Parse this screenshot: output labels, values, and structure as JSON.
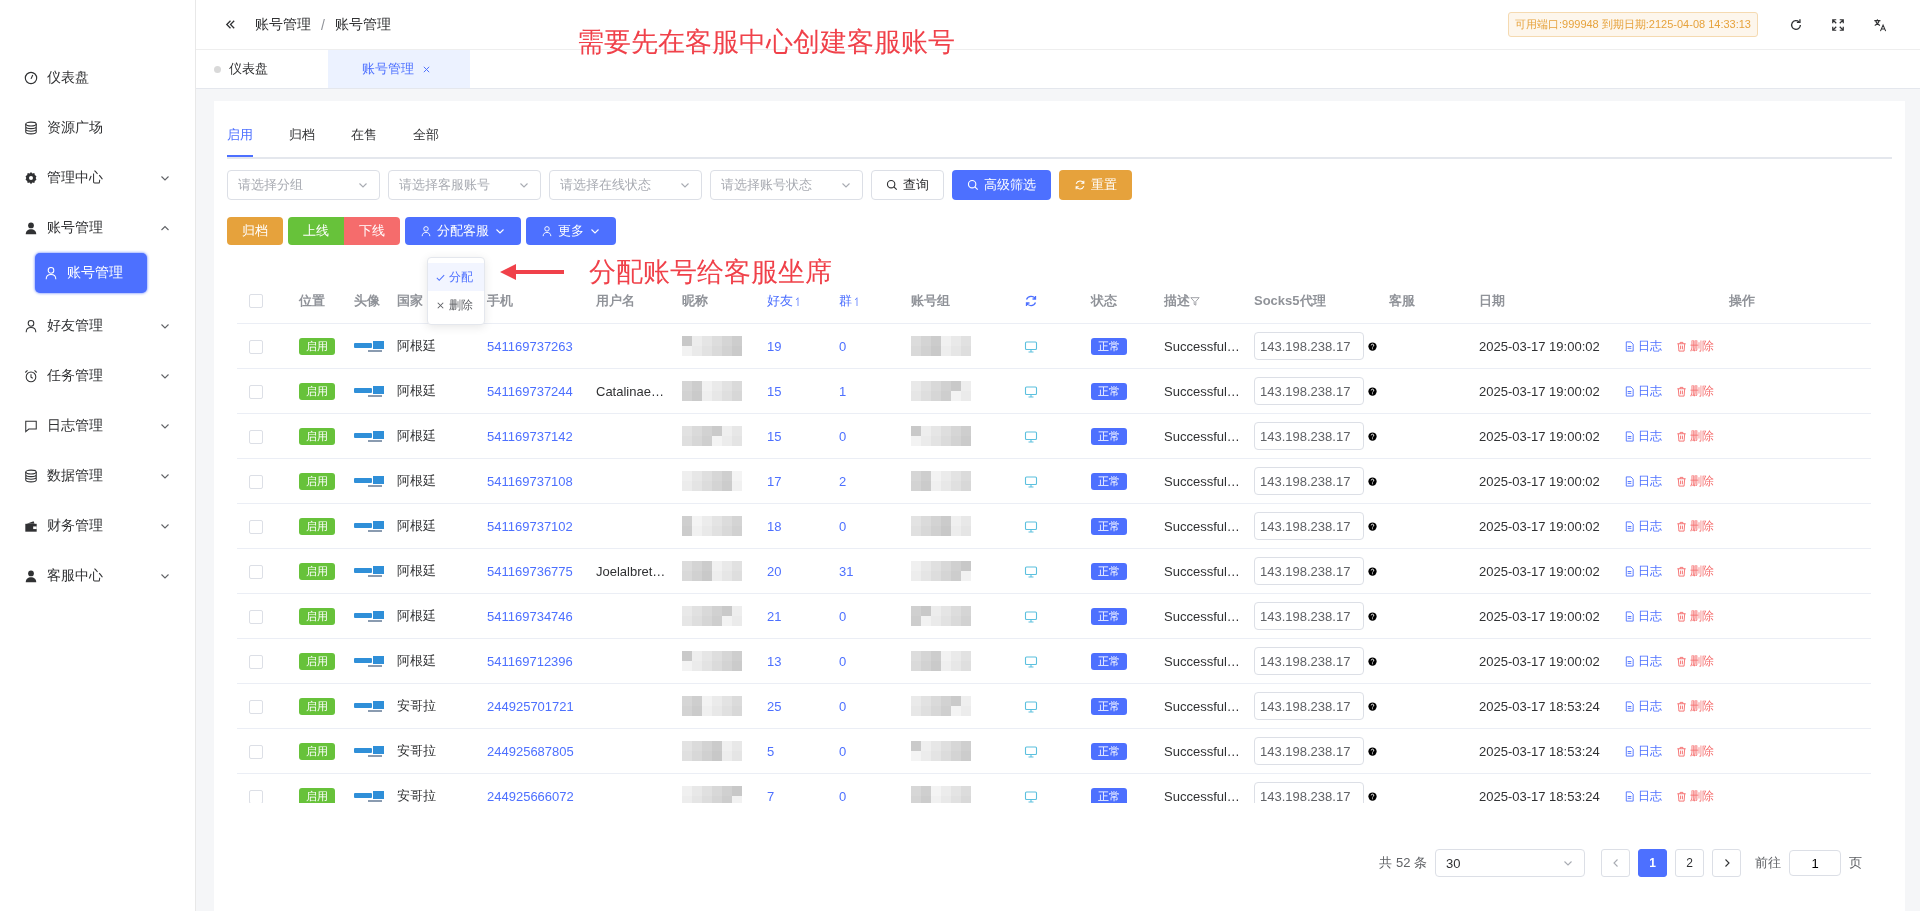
{
  "sidebar": {
    "items": [
      {
        "label": "仪表盘",
        "kind": "link",
        "selected": false
      },
      {
        "label": "资源广场",
        "kind": "link",
        "selected": false
      },
      {
        "label": "管理中心",
        "kind": "group",
        "expanded": false,
        "selected": false
      },
      {
        "label": "账号管理",
        "kind": "group",
        "expanded": true,
        "selected": false,
        "children": [
          {
            "label": "账号管理",
            "selected": true
          }
        ]
      },
      {
        "label": "好友管理",
        "kind": "group",
        "expanded": false,
        "selected": false
      },
      {
        "label": "任务管理",
        "kind": "group",
        "expanded": false,
        "selected": false
      },
      {
        "label": "日志管理",
        "kind": "group",
        "expanded": false,
        "selected": false
      },
      {
        "label": "数据管理",
        "kind": "group",
        "expanded": false,
        "selected": false
      },
      {
        "label": "财务管理",
        "kind": "group",
        "expanded": false,
        "selected": false
      },
      {
        "label": "客服中心",
        "kind": "group",
        "expanded": false,
        "selected": false
      }
    ]
  },
  "header": {
    "breadcrumb": [
      "账号管理",
      "账号管理"
    ],
    "breadcrumb_separator": "/",
    "license_badge": "可用端口:999948 到期日期:2125-04-08 14:33:13"
  },
  "page_tabs": [
    {
      "label": "仪表盘",
      "selected": false,
      "closable": false
    },
    {
      "label": "账号管理",
      "selected": true,
      "closable": true
    }
  ],
  "annotations": {
    "top_note": "需要先在客服中心创建客服账号",
    "arrow_note": "分配账号给客服坐席"
  },
  "content_tabs": [
    {
      "label": "启用",
      "selected": true
    },
    {
      "label": "归档",
      "selected": false
    },
    {
      "label": "在售",
      "selected": false
    },
    {
      "label": "全部",
      "selected": false
    }
  ],
  "filters": [
    {
      "placeholder": "请选择分组"
    },
    {
      "placeholder": "请选择客服账号"
    },
    {
      "placeholder": "请选择在线状态"
    },
    {
      "placeholder": "请选择账号状态"
    }
  ],
  "filter_buttons": [
    {
      "label": "查询",
      "kind": "plain"
    },
    {
      "label": "高级筛选",
      "kind": "primary"
    },
    {
      "label": "重置",
      "kind": "warning"
    }
  ],
  "action_buttons": [
    {
      "label": "归档",
      "kind": "warning"
    },
    {
      "label": "上线",
      "kind": "success"
    },
    {
      "label": "下线",
      "kind": "danger"
    },
    {
      "label": "分配客服",
      "kind": "dropdown"
    },
    {
      "label": "更多",
      "kind": "dropdown"
    }
  ],
  "assign_menu": [
    {
      "label": "分配",
      "kind": "check",
      "selected": true
    },
    {
      "label": "删除",
      "kind": "close",
      "selected": false
    }
  ],
  "table": {
    "header_checked": false,
    "columns": [
      {
        "kind": "check"
      },
      {
        "label": "位置",
        "kind": "text"
      },
      {
        "label": "头像",
        "kind": "text"
      },
      {
        "label": "国家",
        "kind": "text"
      },
      {
        "label": "手机",
        "kind": "text"
      },
      {
        "label": "用户名",
        "kind": "text"
      },
      {
        "label": "昵称",
        "kind": "text"
      },
      {
        "label": "好友",
        "kind": "sort"
      },
      {
        "label": "群",
        "kind": "sort"
      },
      {
        "label": "账号组",
        "kind": "text"
      },
      {
        "kind": "refresh"
      },
      {
        "label": "状态",
        "kind": "text"
      },
      {
        "label": "描述",
        "kind": "filter"
      },
      {
        "label": "Socks5代理",
        "kind": "text"
      },
      {
        "label": "客服",
        "kind": "text"
      },
      {
        "label": "日期",
        "kind": "text"
      },
      {
        "label": "操作",
        "kind": "center"
      }
    ],
    "rows": [
      {
        "checked": false,
        "position": "启用",
        "country": "阿根廷",
        "phone": "541169737263",
        "friends": "19",
        "groups": "0",
        "status": "正常",
        "description": "Successful…",
        "proxy": "143.198.238.17",
        "date": "2025-03-17 19:00:02",
        "actions": [
          {
            "label": "日志",
            "kind": "log"
          },
          {
            "label": "删除",
            "kind": "delete"
          }
        ]
      },
      {
        "checked": false,
        "position": "启用",
        "country": "阿根廷",
        "phone": "541169737244",
        "username": "Catalinae…",
        "friends": "15",
        "groups": "1",
        "status": "正常",
        "description": "Successful…",
        "proxy": "143.198.238.17",
        "date": "2025-03-17 19:00:02",
        "actions": [
          {
            "label": "日志",
            "kind": "log"
          },
          {
            "label": "删除",
            "kind": "delete"
          }
        ]
      },
      {
        "checked": false,
        "position": "启用",
        "country": "阿根廷",
        "phone": "541169737142",
        "friends": "15",
        "groups": "0",
        "status": "正常",
        "description": "Successful…",
        "proxy": "143.198.238.17",
        "date": "2025-03-17 19:00:02",
        "actions": [
          {
            "label": "日志",
            "kind": "log"
          },
          {
            "label": "删除",
            "kind": "delete"
          }
        ]
      },
      {
        "checked": false,
        "position": "启用",
        "country": "阿根廷",
        "phone": "541169737108",
        "friends": "17",
        "groups": "2",
        "status": "正常",
        "description": "Successful…",
        "proxy": "143.198.238.17",
        "date": "2025-03-17 19:00:02",
        "actions": [
          {
            "label": "日志",
            "kind": "log"
          },
          {
            "label": "删除",
            "kind": "delete"
          }
        ]
      },
      {
        "checked": false,
        "position": "启用",
        "country": "阿根廷",
        "phone": "541169737102",
        "friends": "18",
        "groups": "0",
        "status": "正常",
        "description": "Successful…",
        "proxy": "143.198.238.17",
        "date": "2025-03-17 19:00:02",
        "actions": [
          {
            "label": "日志",
            "kind": "log"
          },
          {
            "label": "删除",
            "kind": "delete"
          }
        ]
      },
      {
        "checked": false,
        "position": "启用",
        "country": "阿根廷",
        "phone": "541169736775",
        "username": "Joelalbret…",
        "friends": "20",
        "groups": "31",
        "status": "正常",
        "description": "Successful…",
        "proxy": "143.198.238.17",
        "date": "2025-03-17 19:00:02",
        "actions": [
          {
            "label": "日志",
            "kind": "log"
          },
          {
            "label": "删除",
            "kind": "delete"
          }
        ]
      },
      {
        "checked": false,
        "position": "启用",
        "country": "阿根廷",
        "phone": "541169734746",
        "friends": "21",
        "groups": "0",
        "status": "正常",
        "description": "Successful…",
        "proxy": "143.198.238.17",
        "date": "2025-03-17 19:00:02",
        "actions": [
          {
            "label": "日志",
            "kind": "log"
          },
          {
            "label": "删除",
            "kind": "delete"
          }
        ]
      },
      {
        "checked": false,
        "position": "启用",
        "country": "阿根廷",
        "phone": "541169712396",
        "friends": "13",
        "groups": "0",
        "status": "正常",
        "description": "Successful…",
        "proxy": "143.198.238.17",
        "date": "2025-03-17 19:00:02",
        "actions": [
          {
            "label": "日志",
            "kind": "log"
          },
          {
            "label": "删除",
            "kind": "delete"
          }
        ]
      },
      {
        "checked": false,
        "position": "启用",
        "country": "安哥拉",
        "phone": "244925701721",
        "friends": "25",
        "groups": "0",
        "status": "正常",
        "description": "Successful…",
        "proxy": "143.198.238.17",
        "date": "2025-03-17 18:53:24",
        "actions": [
          {
            "label": "日志",
            "kind": "log"
          },
          {
            "label": "删除",
            "kind": "delete"
          }
        ]
      },
      {
        "checked": false,
        "position": "启用",
        "country": "安哥拉",
        "phone": "244925687805",
        "friends": "5",
        "groups": "0",
        "status": "正常",
        "description": "Successful…",
        "proxy": "143.198.238.17",
        "date": "2025-03-17 18:53:24",
        "actions": [
          {
            "label": "日志",
            "kind": "log"
          },
          {
            "label": "删除",
            "kind": "delete"
          }
        ]
      },
      {
        "checked": false,
        "position": "启用",
        "country": "安哥拉",
        "phone": "244925666072",
        "friends": "7",
        "groups": "0",
        "status": "正常",
        "description": "Successful…",
        "proxy": "143.198.238.17",
        "date": "2025-03-17 18:53:24",
        "actions": [
          {
            "label": "日志",
            "kind": "log"
          },
          {
            "label": "删除",
            "kind": "delete"
          }
        ]
      }
    ]
  },
  "pagination": {
    "total": "共 52 条",
    "page_size": "30",
    "pages": [
      {
        "label": "1",
        "selected": true
      },
      {
        "label": "2",
        "selected": false
      }
    ],
    "goto_label": "前往",
    "goto_value": "1",
    "page_unit": "页"
  }
}
